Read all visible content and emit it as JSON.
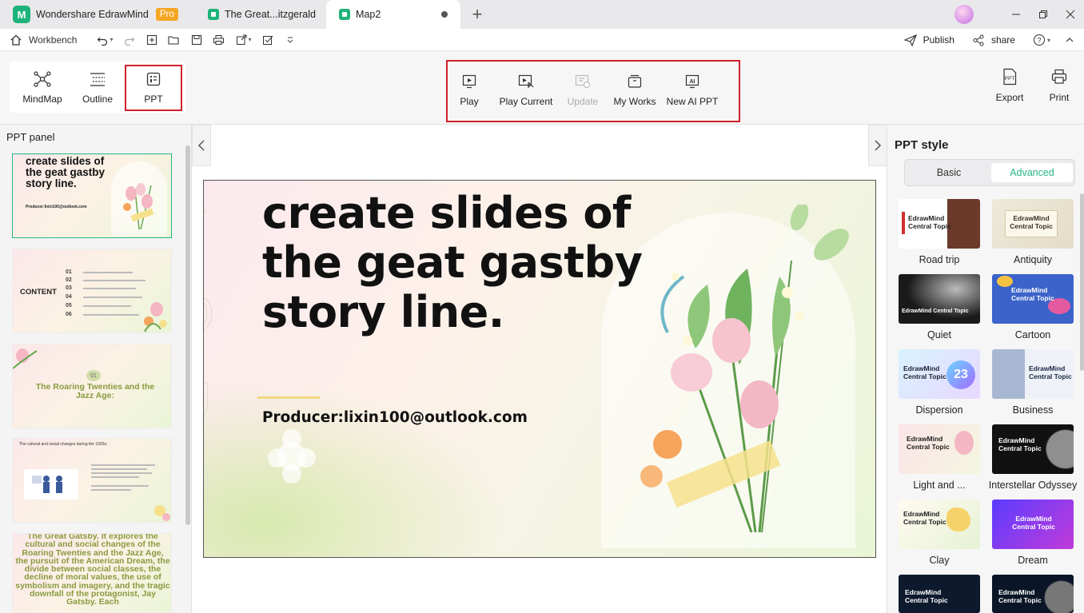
{
  "titlebar": {
    "app_name": "Wondershare EdrawMind",
    "pro_badge": "Pro",
    "tabs": [
      {
        "label": "The Great...itzgerald"
      },
      {
        "label": "Map2"
      }
    ]
  },
  "quickbar": {
    "workbench": "Workbench",
    "publish": "Publish",
    "share": "share"
  },
  "views": {
    "mindmap": "MindMap",
    "outline": "Outline",
    "ppt": "PPT"
  },
  "presentation": {
    "play": "Play",
    "play_current": "Play Current",
    "update": "Update",
    "my_works": "My Works",
    "new_ai_ppt": "New AI PPT"
  },
  "ribbon_right": {
    "export": "Export",
    "print": "Print"
  },
  "left_panel": {
    "title": "PPT panel",
    "slides": [
      {
        "title": "create slides of the geat gastby story line.",
        "subtitle": "Producer:lixin100@outlook.com"
      },
      {
        "heading": "CONTENT",
        "numbers": [
          "01",
          "02",
          "03",
          "04",
          "05",
          "06"
        ]
      },
      {
        "number": "01",
        "title": "The Roaring Twenties and the Jazz Age:"
      },
      {
        "title": "The cultural and social changes during the 1920s:"
      },
      {
        "body": "The Great Gatsby. It explores the cultural and social changes of the Roaring Twenties and the Jazz Age, the pursuit of the American Dream, the divide between social classes, the decline of moral values, the use of symbolism and imagery, and the tragic downfall of the protagonist, Jay Gatsby. Each"
      }
    ]
  },
  "slide": {
    "title": "create slides of the geat gastby story line.",
    "producer": "Producer:lixin100@outlook.com"
  },
  "right_panel": {
    "title": "PPT style",
    "tab_basic": "Basic",
    "tab_advanced": "Advanced",
    "card_text": "EdrawMind Central Topic",
    "styles": [
      {
        "label": "Road trip"
      },
      {
        "label": "Antiquity"
      },
      {
        "label": "Quiet"
      },
      {
        "label": "Cartoon"
      },
      {
        "label": "Dispersion"
      },
      {
        "label": "Business"
      },
      {
        "label": "Light and ..."
      },
      {
        "label": "Interstellar Odyssey"
      },
      {
        "label": "Clay"
      },
      {
        "label": "Dream"
      }
    ]
  },
  "colors": {
    "accent_green": "#27b681",
    "highlight_red": "#d0202a",
    "pro_orange": "#f5a623"
  }
}
